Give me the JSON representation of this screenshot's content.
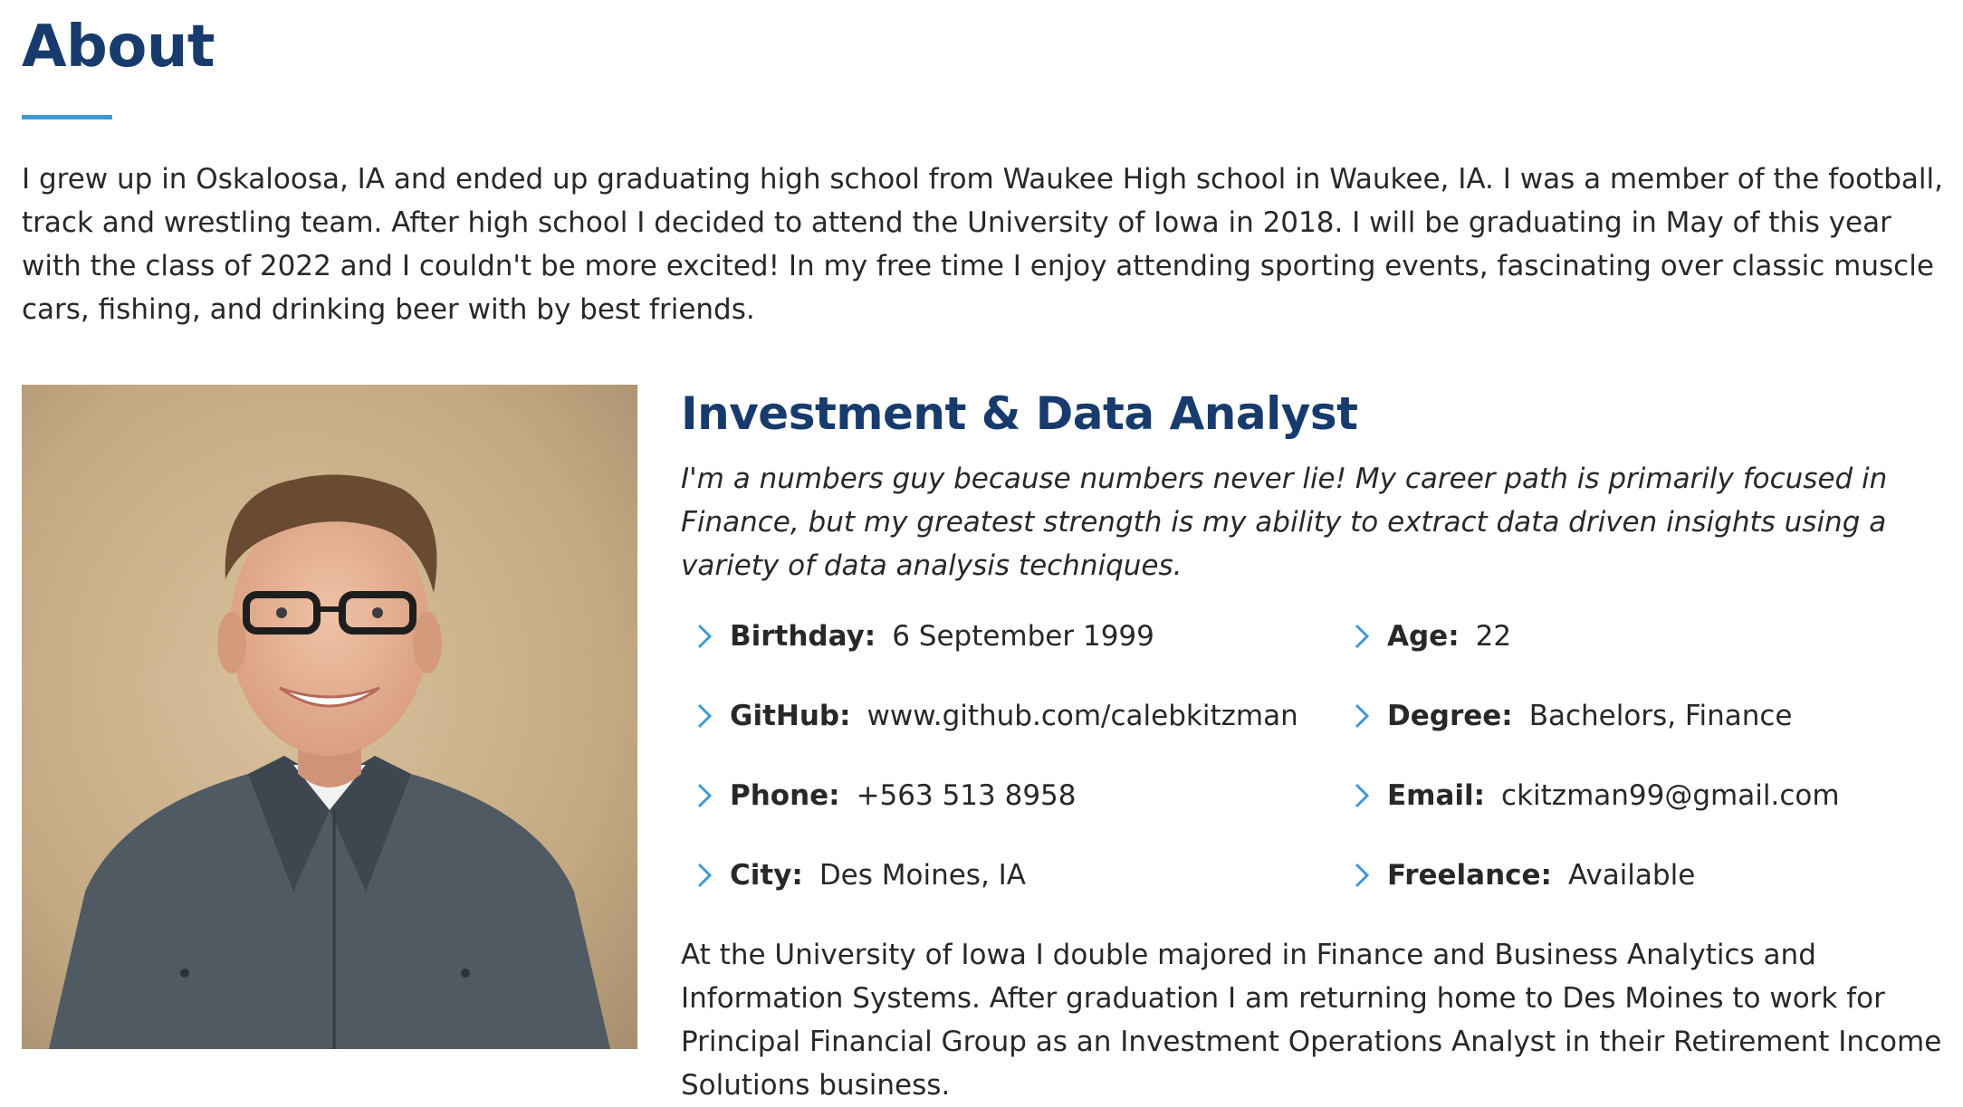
{
  "about": {
    "title": "About",
    "intro": "I grew up in Oskaloosa, IA and ended up graduating high school from Waukee High school in Waukee, IA. I was a member of the football, track and wrestling team. After high school I decided to attend the University of Iowa in 2018. I will be graduating in May of this year with the class of 2022 and I couldn't be more excited! In my free time I enjoy attending sporting events, fascinating over classic muscle cars, fishing, and drinking beer with by best friends."
  },
  "profile": {
    "role_title": "Investment & Data Analyst",
    "summary": "I'm a numbers guy because numbers never lie! My career path is primarily focused in Finance, but my greatest strength is my ability to extract data driven insights using a variety of data analysis techniques.",
    "facts": {
      "birthday": {
        "label": "Birthday:",
        "value": "6 September 1999"
      },
      "github": {
        "label": "GitHub:",
        "value": "www.github.com/calebkitzman"
      },
      "phone": {
        "label": "Phone:",
        "value": "+563 513 8958"
      },
      "city": {
        "label": "City:",
        "value": "Des Moines, IA"
      },
      "age": {
        "label": "Age:",
        "value": "22"
      },
      "degree": {
        "label": "Degree:",
        "value": "Bachelors, Finance"
      },
      "email": {
        "label": "Email:",
        "value": "ckitzman99@gmail.com"
      },
      "freelance": {
        "label": "Freelance:",
        "value": "Available"
      }
    },
    "outro": "At the University of Iowa I double majored in Finance and Business Analytics and Information Systems. After graduation I am returning home to Des Moines to work for Principal Financial Group as an Investment Operations Analyst in their Retirement Income Solutions business."
  },
  "colors": {
    "heading": "#173b6c",
    "accent": "#3f99d6",
    "text": "#272829"
  },
  "icons": {
    "fact_bullet": "chevron-right-icon"
  }
}
